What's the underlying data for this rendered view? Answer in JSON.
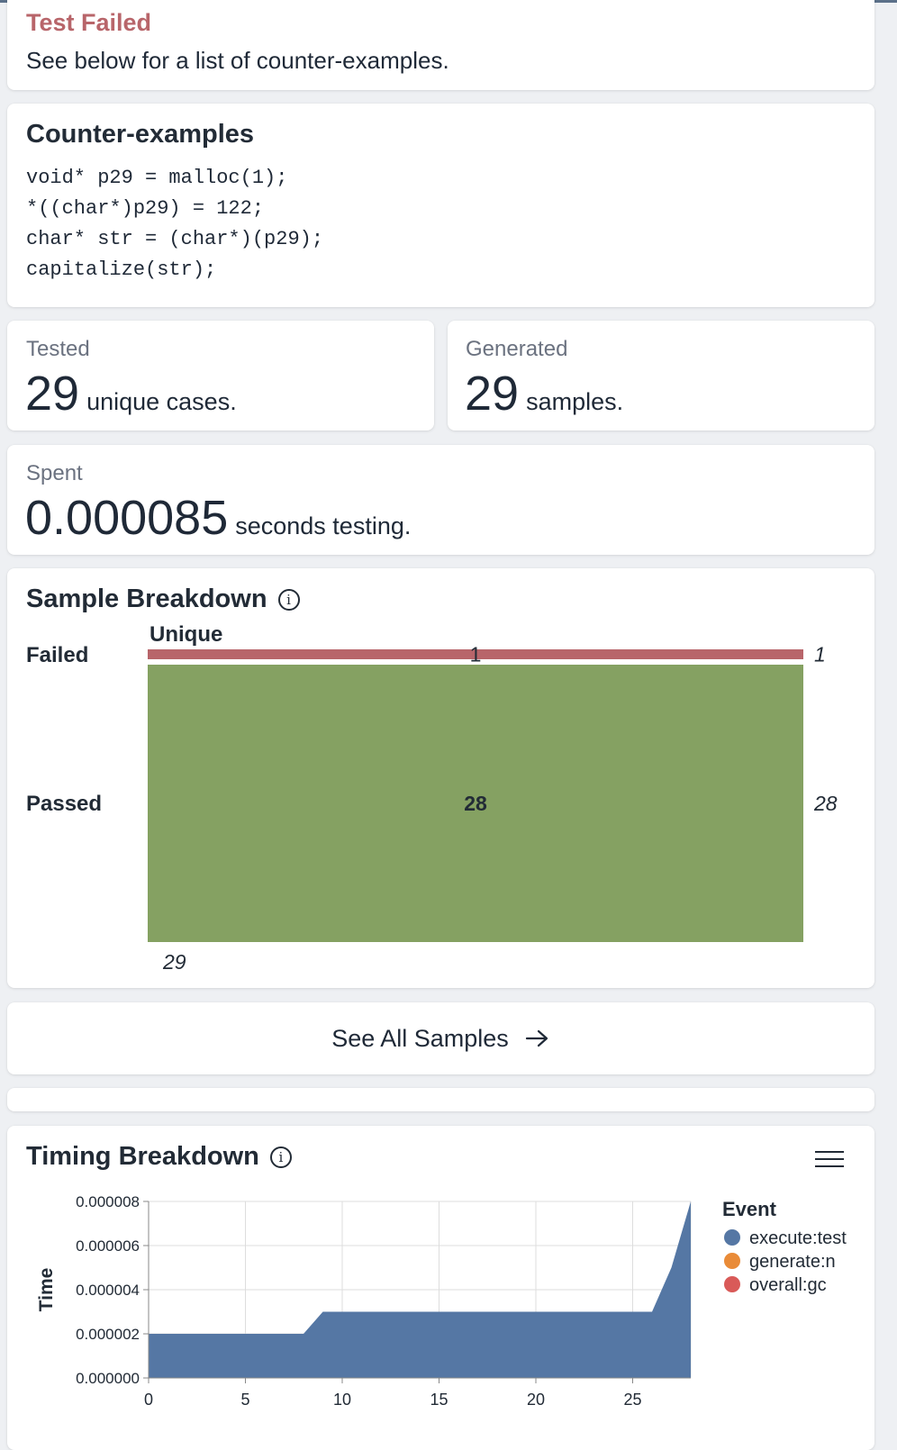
{
  "status": {
    "title": "Test Failed",
    "message": "See below for a list of counter-examples."
  },
  "counter_examples": {
    "title": "Counter-examples",
    "lines": [
      "void* p29 = malloc(1);",
      "*((char*)p29) = 122;",
      "char* str = (char*)(p29);",
      "capitalize(str);"
    ]
  },
  "stats": {
    "tested": {
      "label": "Tested",
      "value": "29",
      "unit": "unique cases."
    },
    "generated": {
      "label": "Generated",
      "value": "29",
      "unit": "samples."
    },
    "spent": {
      "label": "Spent",
      "value": "0.000085",
      "unit": "seconds testing."
    }
  },
  "sample_breakdown": {
    "title": "Sample Breakdown",
    "info_icon": "info-icon",
    "column_label": "Unique",
    "total_label": "29",
    "colors": {
      "failed": "#b8656a",
      "passed": "#85a162"
    }
  },
  "see_all": {
    "label": "See All Samples",
    "icon": "arrow-right-icon"
  },
  "timing_breakdown": {
    "title": "Timing Breakdown",
    "info_icon": "info-icon",
    "menu_icon": "hamburger-menu-icon"
  },
  "chart_data": [
    {
      "type": "bar",
      "categories": [
        "Failed",
        "Passed"
      ],
      "values": [
        1,
        28
      ],
      "data_labels": [
        "1",
        "28"
      ],
      "side_labels": [
        "1",
        "28"
      ],
      "colors": [
        "#b8656a",
        "#85a162"
      ]
    },
    {
      "type": "area",
      "ylabel": "Time",
      "legend_title": "Event",
      "legend_placement": "right",
      "x_ticks": [
        "0",
        "5",
        "10",
        "15",
        "20",
        "25"
      ],
      "y_ticks": [
        "0.000000",
        "0.000002",
        "0.000004",
        "0.000006",
        "0.000008"
      ],
      "xlim": [
        0,
        28
      ],
      "ylim": [
        0,
        8e-06
      ],
      "grid": true,
      "series": [
        {
          "name": "execute:test",
          "color": "#5577a4",
          "x": [
            0,
            8,
            9,
            26,
            27,
            28
          ],
          "y": [
            2e-06,
            2e-06,
            3e-06,
            3e-06,
            5e-06,
            8e-06
          ]
        },
        {
          "name": "generate:n",
          "color": "#e98b38",
          "x": [],
          "y": []
        },
        {
          "name": "overall:gc",
          "color": "#d95a58",
          "x": [],
          "y": []
        }
      ]
    }
  ]
}
